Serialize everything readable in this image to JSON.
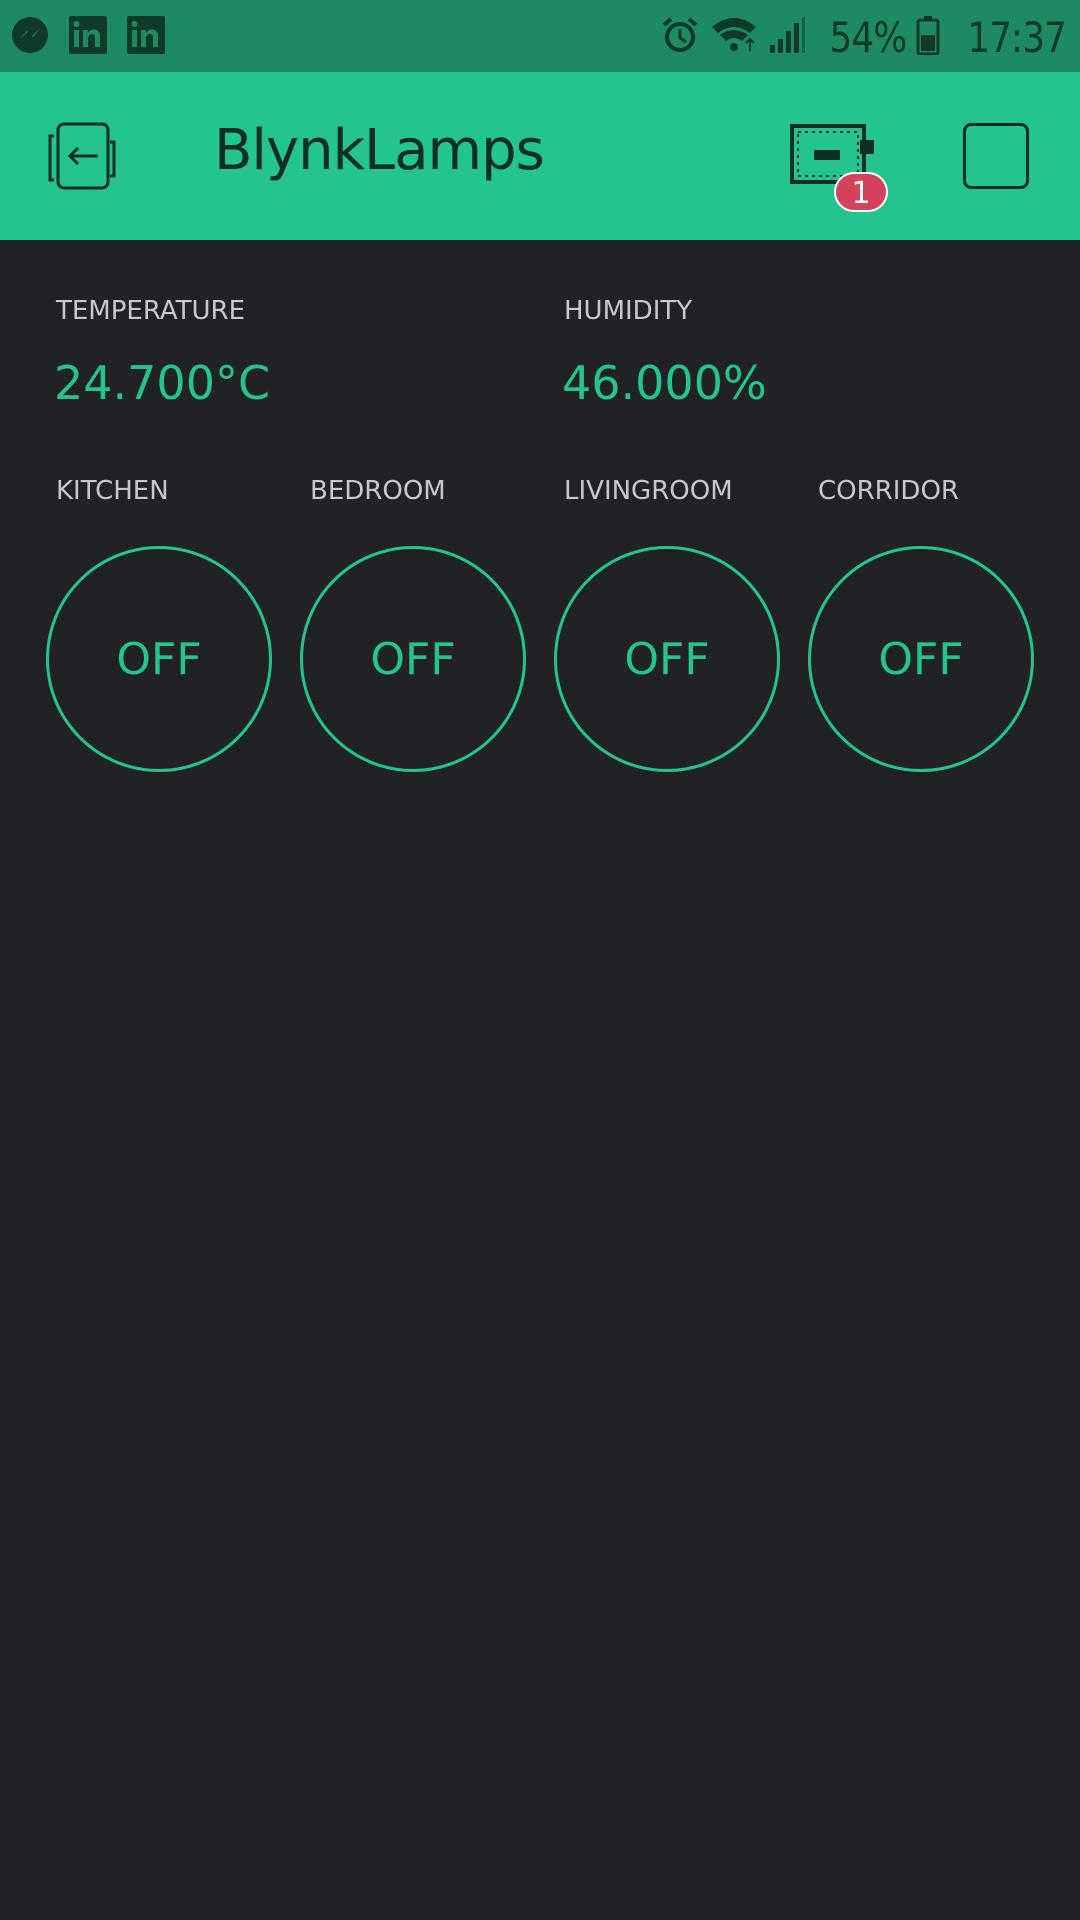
{
  "status_bar": {
    "battery": "54%",
    "time": "17:37",
    "icons": [
      "messenger-icon",
      "linkedin-icon",
      "linkedin-icon",
      "alarm-icon",
      "wifi-icon",
      "signal-icon",
      "battery-icon"
    ]
  },
  "app_bar": {
    "title": "BlynkLamps",
    "back_icon": "exit-icon",
    "device_icon": "device-board-icon",
    "device_badge": "1",
    "play_icon": "play-square-icon"
  },
  "displays": [
    {
      "label": "TEMPERATURE",
      "value": "24.700°C"
    },
    {
      "label": "HUMIDITY",
      "value": "46.000%"
    }
  ],
  "lamps": [
    {
      "label": "KITCHEN",
      "state": "OFF"
    },
    {
      "label": "BEDROOM",
      "state": "OFF"
    },
    {
      "label": "LIVINGROOM",
      "state": "OFF"
    },
    {
      "label": "CORRIDOR",
      "state": "OFF"
    }
  ],
  "colors": {
    "accent": "#23c48e",
    "background": "#212226",
    "status_bar": "#1e8a64",
    "badge": "#d3435c"
  }
}
